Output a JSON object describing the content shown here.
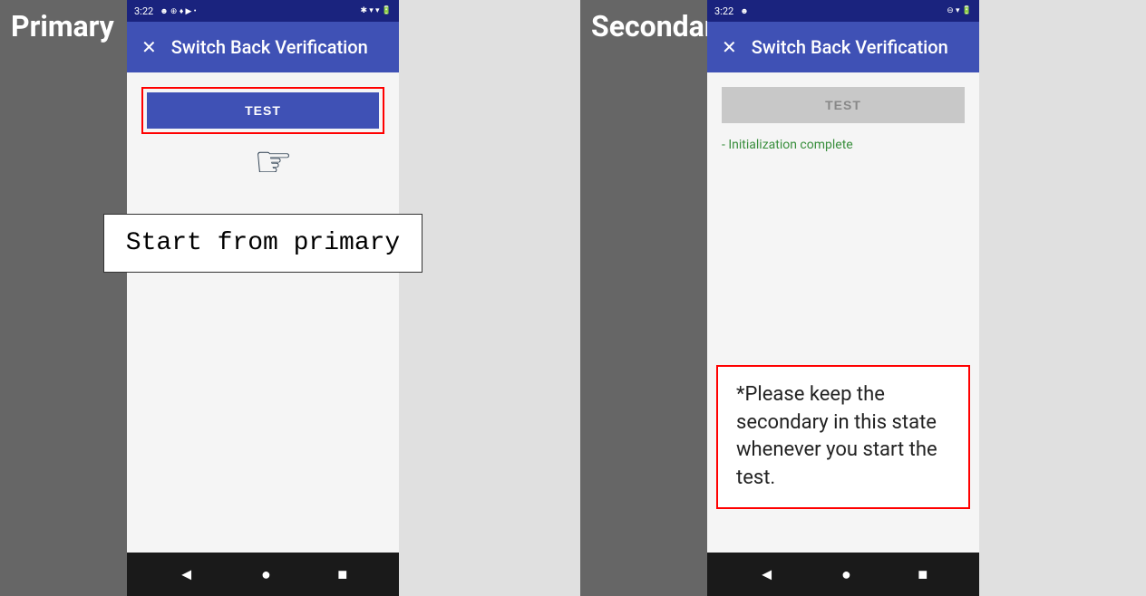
{
  "primary": {
    "label": "Primary",
    "statusBar": {
      "time": "3:22",
      "leftIcons": "☻ ⊕ ♦ ▶ •",
      "rightIcons": "✱ ▼ 📶 🔋"
    },
    "appBar": {
      "closeIcon": "✕",
      "title": "Switch Back Verification"
    },
    "testButton": "TEST",
    "primaryTextBox": "Start from primary",
    "navBar": {
      "back": "◄",
      "home": "●",
      "square": "■"
    }
  },
  "secondary": {
    "label": "Secondary",
    "statusBar": {
      "time": "3:22",
      "leftIcons": "☻",
      "rightIcons": "⊖ ▼ 🔋"
    },
    "appBar": {
      "closeIcon": "✕",
      "title": "Switch Back Verification"
    },
    "testButton": "TEST",
    "initText": "- Initialization complete",
    "noteText": "*Please keep the secondary in this state whenever you start the test.",
    "navBar": {
      "back": "◄",
      "home": "●",
      "square": "■"
    }
  }
}
